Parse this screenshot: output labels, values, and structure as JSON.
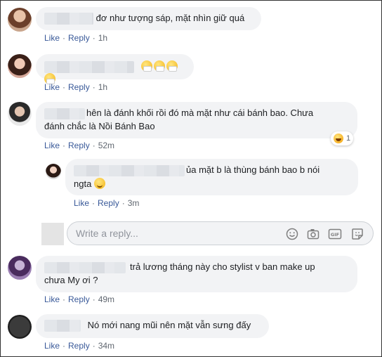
{
  "comments": [
    {
      "text": "đơ như tượng sáp, mặt nhìn giữ quá",
      "like": "Like",
      "reply": "Reply",
      "time": "1h"
    },
    {
      "text": "",
      "emoji_count": 4,
      "like": "Like",
      "reply": "Reply",
      "time": "1h"
    },
    {
      "text_line1": "hên là đánh khối rồi đó mà mặt như cái bánh bao. Chưa",
      "text_line2": "đánh chắc là Nồi Bánh Bao",
      "reaction_count": "1",
      "like": "Like",
      "reply": "Reply",
      "time": "52m"
    },
    {
      "text_line1": "ủa mặt b là thùng bánh bao b nói",
      "text_line2": "ngta",
      "like": "Like",
      "reply": "Reply",
      "time": "3m"
    },
    {
      "text_line1": "trả lương tháng này cho stylist v ban make up",
      "text_line2": "chưa My ơi ?",
      "like": "Like",
      "reply": "Reply",
      "time": "49m"
    },
    {
      "text": "Nó mới nang mũi nên mặt vẫn sưng đấy",
      "like": "Like",
      "reply": "Reply",
      "time": "34m"
    }
  ],
  "reply_box": {
    "placeholder": "Write a reply...",
    "icons": [
      "emoji-icon",
      "camera-icon",
      "gif-icon",
      "sticker-icon"
    ]
  },
  "colors": {
    "link": "#385898",
    "bubble": "#f2f3f5",
    "meta": "#606770"
  }
}
